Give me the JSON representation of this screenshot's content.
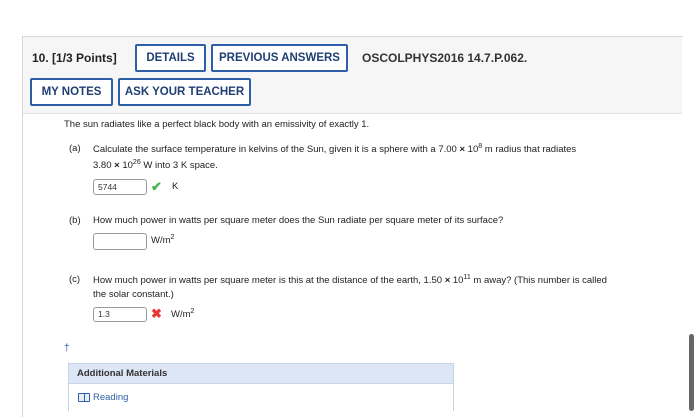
{
  "question": {
    "number": "10.",
    "points": "[1/3 Points]",
    "details_label": "DETAILS",
    "prev_answers_label": "PREVIOUS ANSWERS",
    "code": "OSCOLPHYS2016 14.7.P.062.",
    "my_notes_label": "MY NOTES",
    "ask_teacher_label": "ASK YOUR TEACHER"
  },
  "problem": {
    "intro": "The sun radiates like a perfect black body with an emissivity of exactly 1.",
    "a": {
      "label": "(a)",
      "line1_pre": "Calculate the surface temperature in kelvins of the Sun, given it is a sphere with a 7.00 ",
      "line1_times": "×",
      "line1_base": " 10",
      "line1_exp": "8",
      "line1_post": " m radius that radiates",
      "line2_pre": "3.80 ",
      "line2_times": "×",
      "line2_base": " 10",
      "line2_exp": "26",
      "line2_post": " W into 3 K space.",
      "answer": "5744",
      "status": "correct",
      "unit": "K"
    },
    "b": {
      "label": "(b)",
      "text": "How much power in watts per square meter does the Sun radiate per square meter of its surface?",
      "answer": "",
      "unit_base": "W/m",
      "unit_exp": "2"
    },
    "c": {
      "label": "(c)",
      "line1_pre": "How much power in watts per square meter is this at the distance of the earth, 1.50 ",
      "line1_times": "×",
      "line1_base": " 10",
      "line1_exp": "11",
      "line1_post": " m away? (This number is called",
      "line2": "the solar constant.)",
      "answer": "1.3",
      "status": "incorrect",
      "unit_base": "W/m",
      "unit_exp": "2"
    }
  },
  "dagger": "†",
  "additional_materials": {
    "title": "Additional Materials",
    "items": [
      "Reading"
    ]
  },
  "colors": {
    "accent": "#2d5ea7",
    "correct": "#4caf50",
    "incorrect": "#e53935",
    "header_bg": "#f6f6f6"
  }
}
